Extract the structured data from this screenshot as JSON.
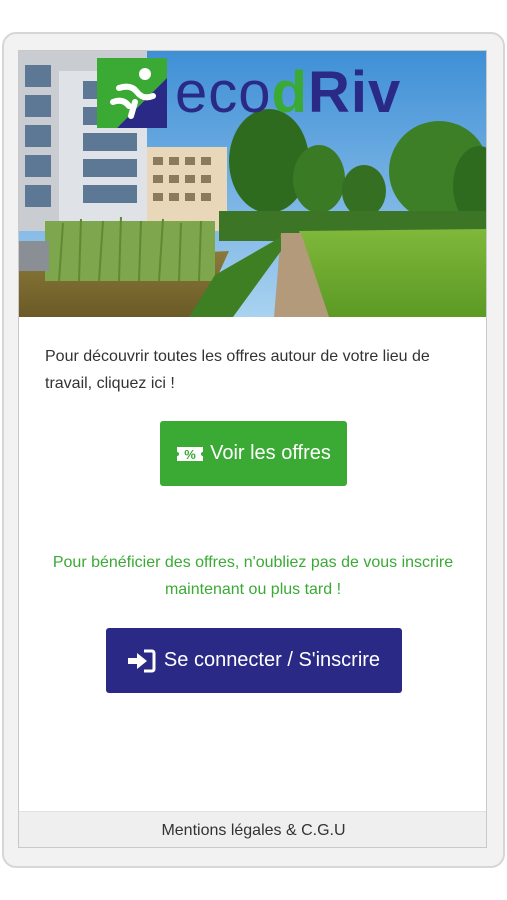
{
  "brand": {
    "logo_prefix": "eco",
    "logo_d": "d",
    "logo_suffix": "Riv",
    "color_primary": "#2a2a86",
    "color_accent": "#3aaa35"
  },
  "hero": {
    "image": "office-park-with-garden-and-canal"
  },
  "intro_text": "Pour découvrir toutes les offres autour de votre lieu de travail, cliquez ici !",
  "offers_button": {
    "label": "Voir les offres",
    "icon": "coupon-percent-icon"
  },
  "promo_text": "Pour bénéficier des offres, n'oubliez pas de vous inscrire maintenant ou plus tard !",
  "login_button": {
    "label": "Se connecter / S'inscrire",
    "icon": "sign-in-icon"
  },
  "footer": {
    "link_label": "Mentions légales & C.G.U"
  }
}
